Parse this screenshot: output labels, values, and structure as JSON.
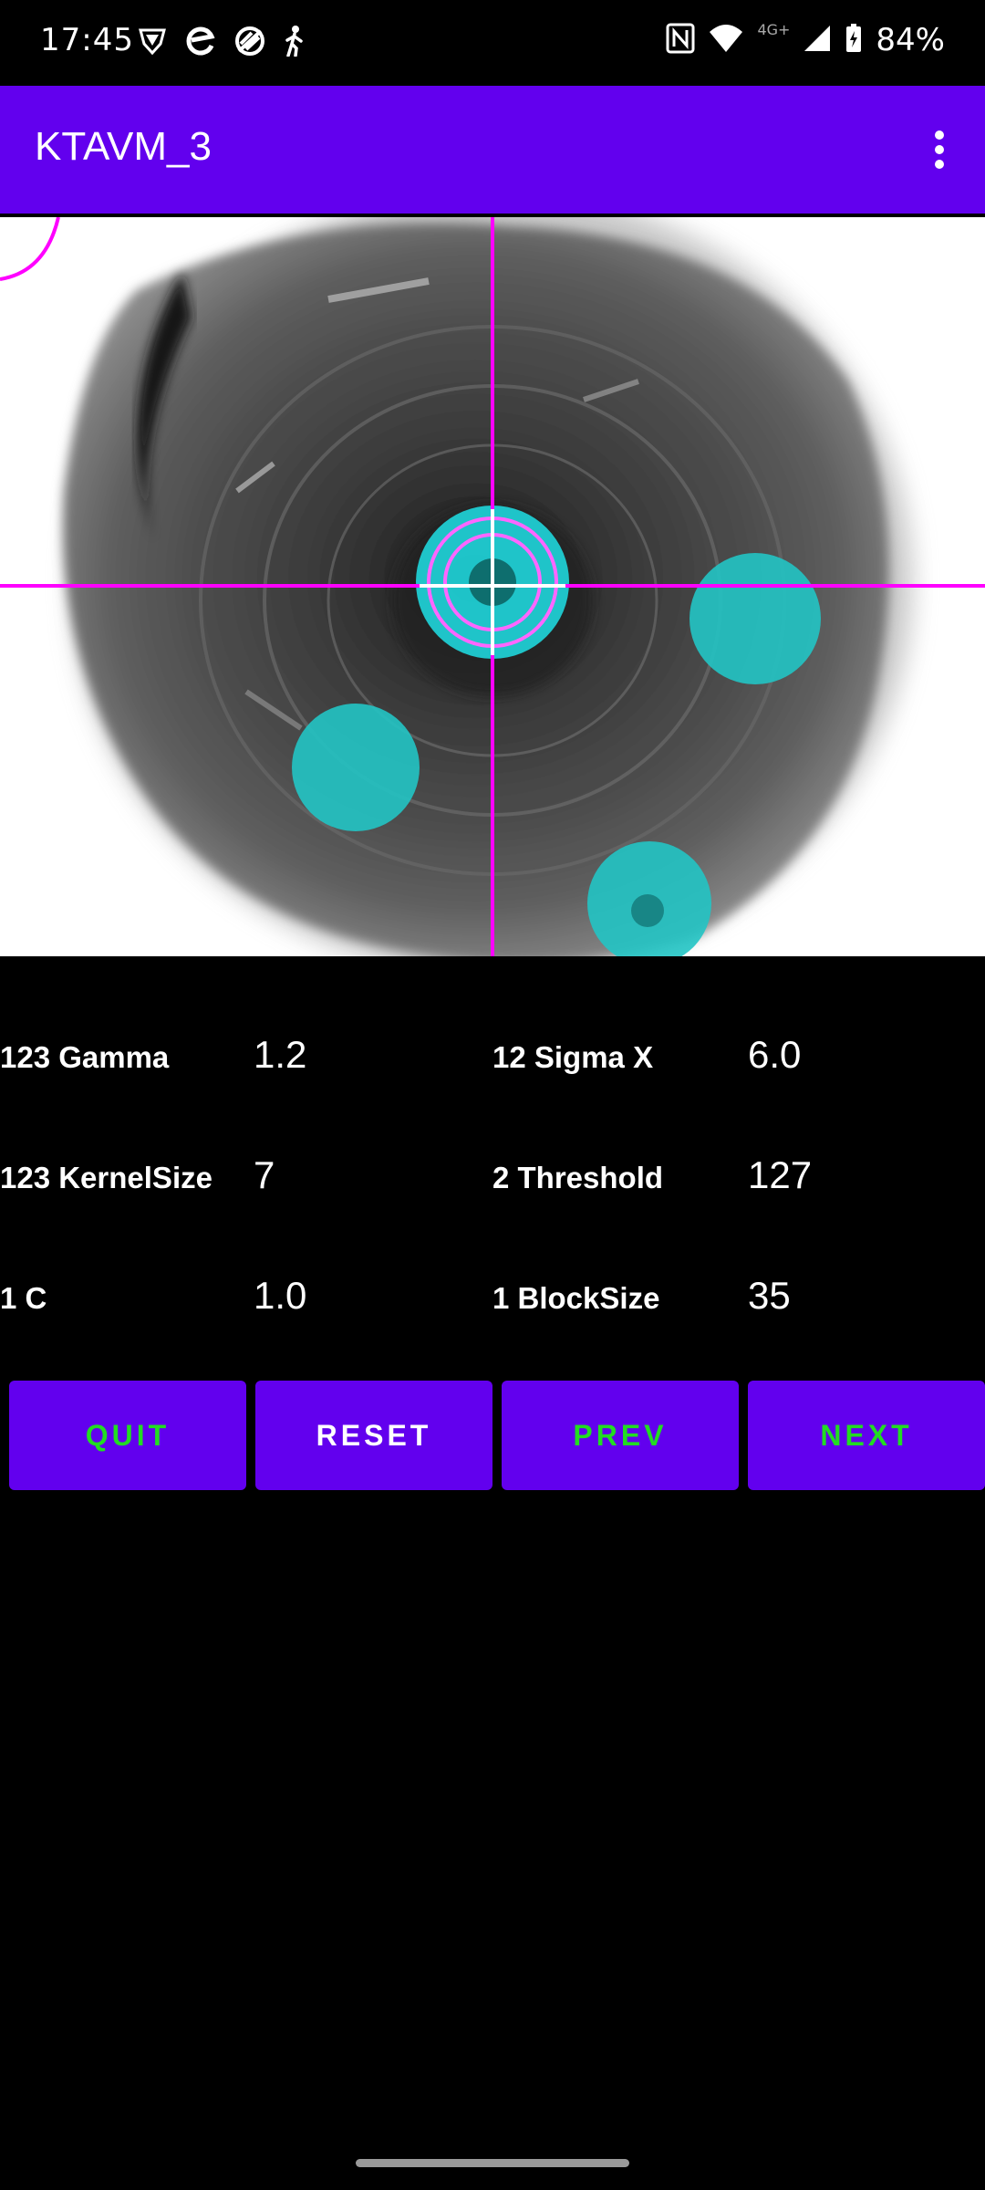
{
  "status_bar": {
    "time": "17:45",
    "battery": "84%",
    "network": "4G+",
    "left_icons": [
      "shield-icon",
      "edge-icon",
      "no-sync-icon",
      "walking-icon"
    ],
    "right_icons": [
      "nfc-icon",
      "wifi-icon",
      "cell-signal-icon",
      "battery-charging-icon"
    ]
  },
  "app_bar": {
    "title": "KTAVM_3",
    "menu_icon": "more-vert-icon",
    "color": "#6200ee"
  },
  "params": {
    "gamma": {
      "label": "123 Gamma",
      "value": "1.2"
    },
    "sigma_x": {
      "label": "12 Sigma X",
      "value": "6.0"
    },
    "kernel_size": {
      "label": "123 KernelSize",
      "value": "7"
    },
    "threshold": {
      "label": "2 Threshold",
      "value": "127"
    },
    "c": {
      "label": "1 C",
      "value": "1.0"
    },
    "block_size": {
      "label": "1 BlockSize",
      "value": "35"
    }
  },
  "buttons": {
    "quit": {
      "label": "QUIT",
      "color": "#22dd22"
    },
    "reset": {
      "label": "RESET",
      "color": "#ffffff"
    },
    "prev": {
      "label": "PREV",
      "color": "#22dd22"
    },
    "next": {
      "label": "NEXT",
      "color": "#22dd22"
    }
  },
  "colors": {
    "accent": "#6200ee",
    "crosshair": "#ff00ff",
    "marker": "#22c4c4"
  }
}
